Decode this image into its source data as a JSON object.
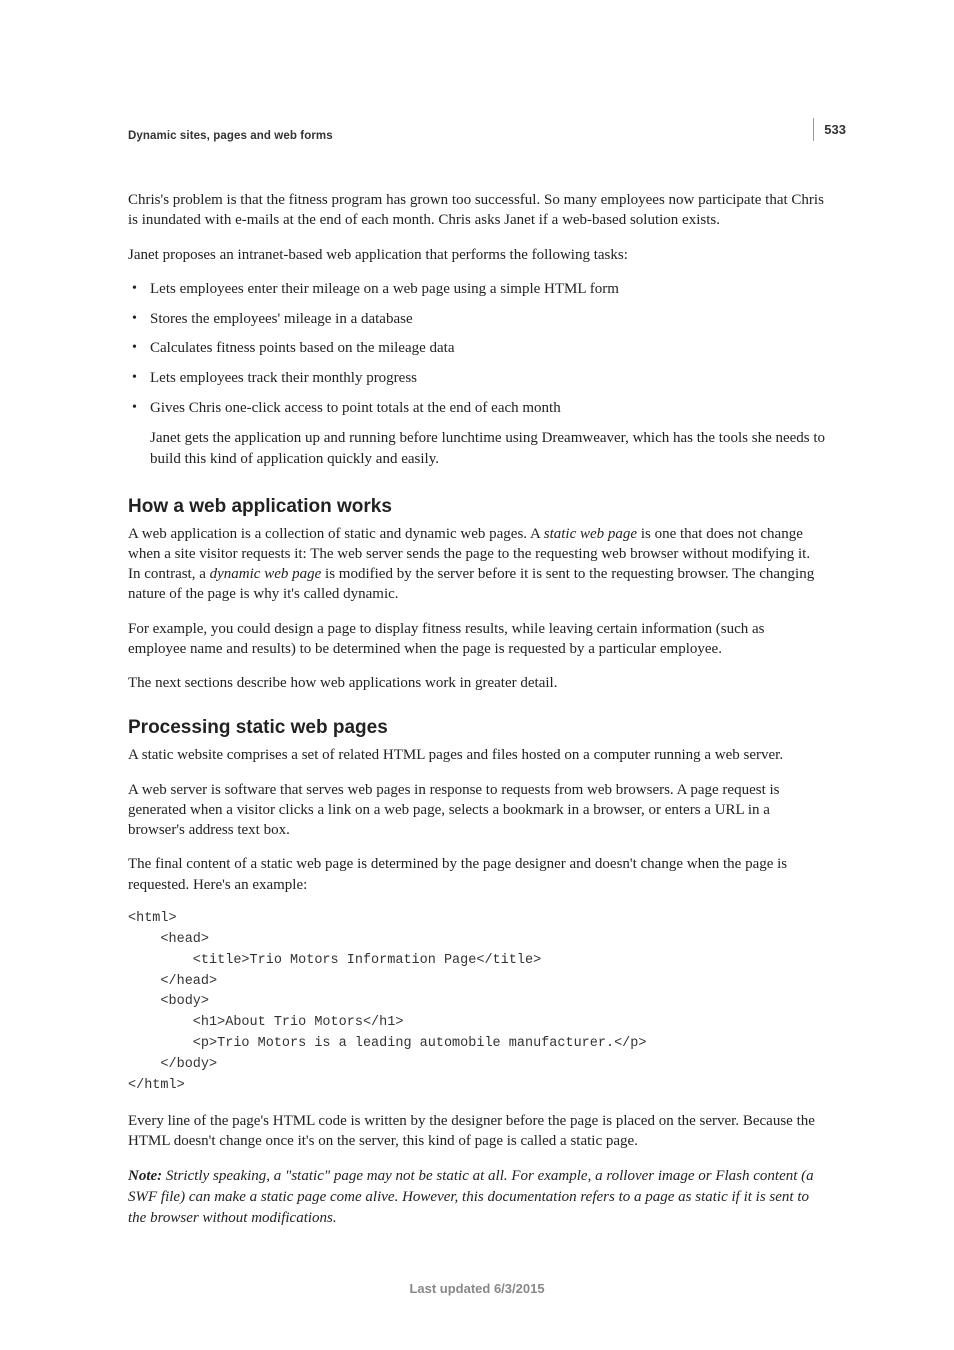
{
  "page_number": "533",
  "running_head": "Dynamic sites, pages and web forms",
  "intro": {
    "p1": "Chris's problem is that the fitness program has grown too successful. So many employees now participate that Chris is inundated with e-mails at the end of each month. Chris asks Janet if a web-based solution exists.",
    "p2": "Janet proposes an intranet-based web application that performs the following tasks:",
    "bullets": [
      "Lets employees enter their mileage on a web page using a simple HTML form",
      "Stores the employees' mileage in a database",
      "Calculates fitness points based on the mileage data",
      "Lets employees track their monthly progress",
      "Gives Chris one-click access to point totals at the end of each month"
    ],
    "after_list": "Janet gets the application up and running before lunchtime using Dreamweaver, which has the tools she needs to build this kind of application quickly and easily."
  },
  "section1": {
    "heading": "How a web application works",
    "p1_pre": "A web application is a collection of static and dynamic web pages. A ",
    "p1_em1": "static web page",
    "p1_mid": " is one that does not change when a site visitor requests it: The web server sends the page to the requesting web browser without modifying it. In contrast, a ",
    "p1_em2": "dynamic web page",
    "p1_post": " is modified by the server before it is sent to the requesting browser. The changing nature of the page is why it's called dynamic.",
    "p2": "For example, you could design a page to display fitness results, while leaving certain information (such as employee name and results) to be determined when the page is requested by a particular employee.",
    "p3": "The next sections describe how web applications work in greater detail."
  },
  "section2": {
    "heading": "Processing static web pages",
    "p1": "A static website comprises a set of related HTML pages and files hosted on a computer running a web server.",
    "p2": "A web server is software that serves web pages in response to requests from web browsers. A page request is generated when a visitor clicks a link on a web page, selects a bookmark in a browser, or enters a URL in a browser's address text box.",
    "p3": "The final content of a static web page is determined by the page designer and doesn't change when the page is requested. Here's an example:",
    "code": "<html>\n    <head>\n        <title>Trio Motors Information Page</title>\n    </head>\n    <body>\n        <h1>About Trio Motors</h1>\n        <p>Trio Motors is a leading automobile manufacturer.</p>\n    </body>\n</html>",
    "p4": "Every line of the page's HTML code is written by the designer before the page is placed on the server. Because the HTML doesn't change once it's on the server, this kind of page is called a static page.",
    "note_label": "Note: ",
    "note_body": "Strictly speaking, a \"static\" page may not be static at all. For example, a rollover image or Flash content (a SWF file) can make a static page come alive. However, this documentation refers to a page as static if it is sent to the browser without modifications."
  },
  "footer": "Last updated 6/3/2015"
}
